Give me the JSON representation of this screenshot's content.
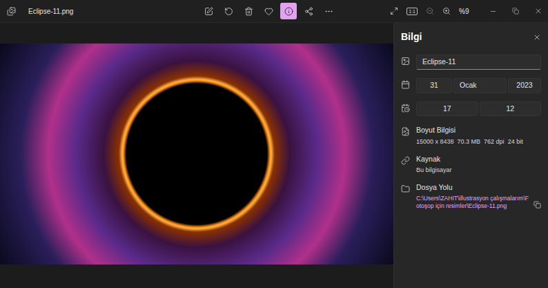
{
  "window": {
    "title": "Eclipse-11.png"
  },
  "toolbar": [
    {
      "icon": "edit",
      "selected": false
    },
    {
      "icon": "rotate",
      "selected": false
    },
    {
      "icon": "delete",
      "selected": false
    },
    {
      "icon": "favorite",
      "selected": false
    },
    {
      "icon": "info",
      "selected": true
    },
    {
      "icon": "share",
      "selected": false
    },
    {
      "icon": "more",
      "selected": false
    }
  ],
  "view_controls": {
    "ratio": "1:1",
    "zoom": "%9"
  },
  "info_panel": {
    "title": "Bilgi",
    "name": "Eclipse-11",
    "date": {
      "day": "31",
      "month": "Ocak",
      "year": "2023"
    },
    "time": {
      "hour": "17",
      "minute": "12"
    },
    "size": {
      "label": "Boyut Bilgisi",
      "values": [
        "15000 x 8438",
        "70.3 MB",
        "762 dpi",
        "24 bit"
      ]
    },
    "source": {
      "label": "Kaynak",
      "value": "Bu bilgisayar"
    },
    "path": {
      "label": "Dosya Yolu",
      "value": "C:\\Users\\ZAHIT\\illustrasyon çalışmalarım\\Fotoşop için resimler\\Eclipse-11.png"
    }
  }
}
